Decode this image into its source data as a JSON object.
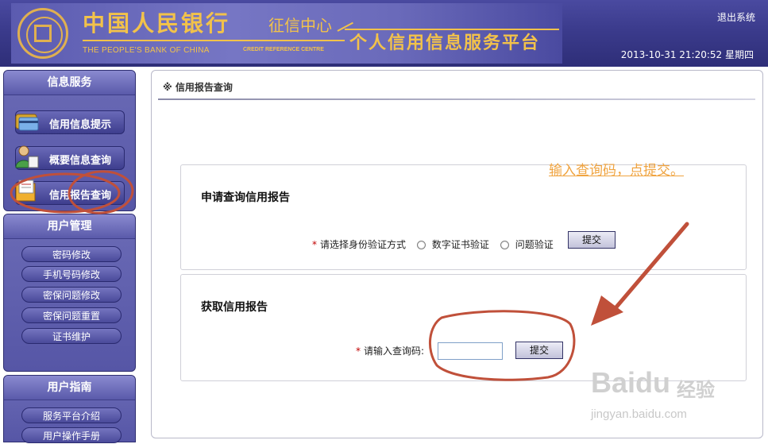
{
  "header": {
    "bank_name_cn": "中国人民银行",
    "center_name_cn": "征信中心",
    "bank_name_en": "THE PEOPLE'S BANK OF CHINA",
    "center_name_en": "CREDIT REFERENCE CENTRE",
    "platform_name": "个人信用信息服务平台",
    "logout": "退出系统",
    "datetime": "2013-10-31 21:20:52 星期四"
  },
  "sidebar": {
    "info_service": {
      "title": "信息服务",
      "items": [
        {
          "label": "信用信息提示",
          "icon": "credit-card-icon"
        },
        {
          "label": "概要信息查询",
          "icon": "person-icon"
        },
        {
          "label": "信用报告查询",
          "icon": "report-icon"
        }
      ]
    },
    "user_management": {
      "title": "用户管理",
      "items": [
        "密码修改",
        "手机号码修改",
        "密保问题修改",
        "密保问题重置",
        "证书维护"
      ]
    },
    "user_guide": {
      "title": "用户指南",
      "items": [
        "服务平台介绍",
        "用户操作手册"
      ]
    }
  },
  "main": {
    "title": "※  信用报告查询",
    "apply_section": {
      "title": "申请查询信用报告",
      "verify_label": "请选择身份验证方式",
      "options": [
        "数字证书验证",
        "问题验证"
      ],
      "submit": "提交"
    },
    "get_section": {
      "title": "获取信用报告",
      "code_label": "请输入查询码:",
      "code_value": "",
      "submit": "提交"
    }
  },
  "annotation": {
    "text": "输入查询码，点提交。",
    "color": "#f0a440",
    "circle_color": "#c0503a"
  },
  "watermark": {
    "logo": "Baidu",
    "cn": "经验",
    "url": "jingyan.baidu.com"
  }
}
